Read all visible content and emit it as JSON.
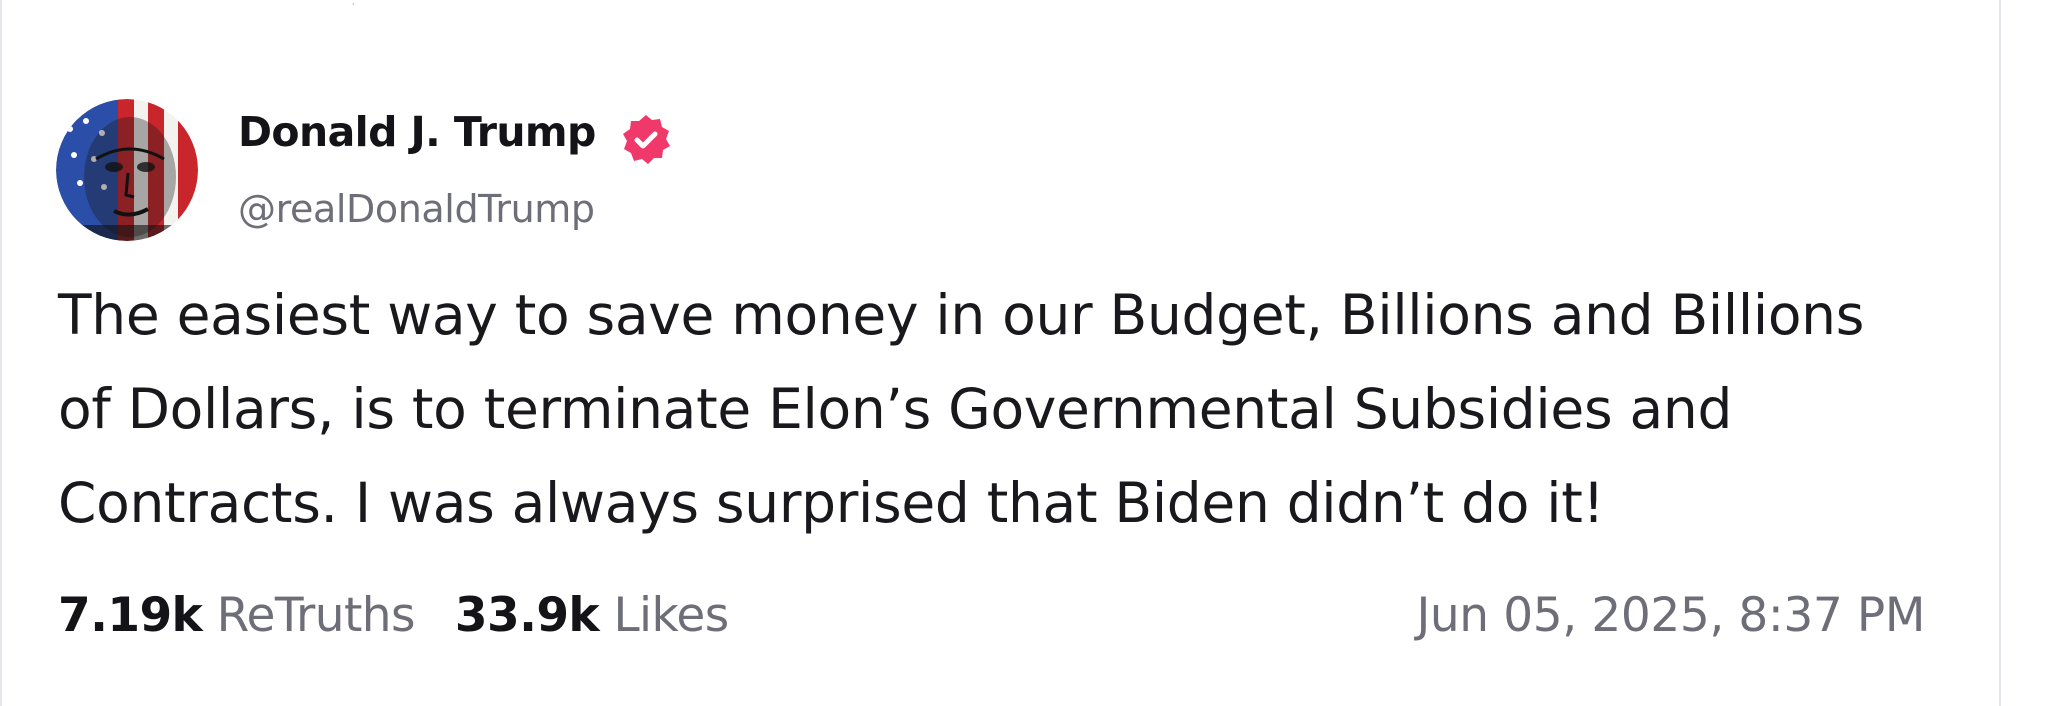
{
  "post": {
    "author": {
      "name": "Donald J. Trump",
      "handle": "@realDonaldTrump",
      "verified_icon": "verified-badge-icon",
      "verified_color": "#f0386b"
    },
    "body_lines": [
      "The easiest way to save money in our Budget, Billions and Billions",
      "of Dollars, is to terminate Elon’s Governmental Subsidies and",
      "Contracts. I was always surprised that Biden didn’t do it!"
    ],
    "stats": {
      "retruths_count": "7.19k",
      "retruths_label": "ReTruths",
      "likes_count": "33.9k",
      "likes_label": "Likes"
    },
    "timestamp": "Jun 05, 2025, 8:37 PM"
  },
  "colors": {
    "text_primary": "#131318",
    "text_secondary": "#6e6e78",
    "border": "#e6e6ea",
    "background": "#ffffff"
  }
}
